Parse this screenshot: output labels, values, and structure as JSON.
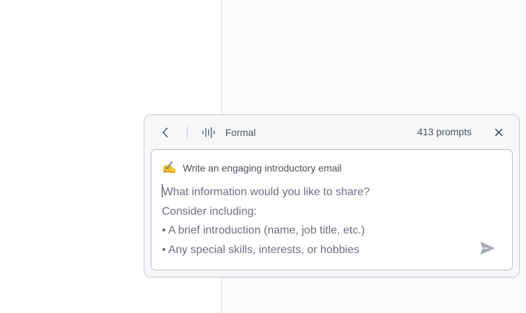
{
  "assistant": {
    "tone_label": "Formal",
    "prompt_count": "413 prompts",
    "prompt_title": "Write an engaging introductory email",
    "prompt_emoji": "✍️",
    "placeholder_lines": [
      "What information would you like to share?",
      "Consider including:",
      "• A brief introduction (name, job title, etc.)",
      "• Any special skills, interests, or hobbies"
    ],
    "icons": {
      "back": "chevron-left-icon",
      "tone": "sound-wave-icon",
      "close": "close-icon",
      "send": "send-icon"
    }
  },
  "colors": {
    "text": "#4a4f5c",
    "placeholder": "#6b7080",
    "send": "#a7abb7",
    "border": "#c9cbd3"
  }
}
